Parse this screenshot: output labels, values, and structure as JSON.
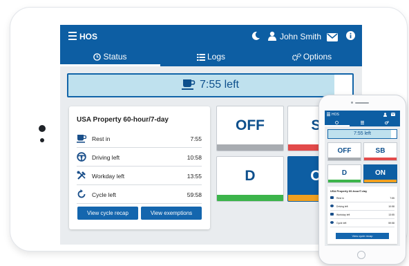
{
  "app": {
    "title": "HOS",
    "user_name": "John Smith"
  },
  "tabs": [
    {
      "label": "Status"
    },
    {
      "label": "Logs"
    },
    {
      "label": "Options"
    }
  ],
  "time_left": {
    "text": "7:55 left",
    "fraction_used": 0.94
  },
  "summary": {
    "title": "USA Property 60-hour/7-day",
    "rows": [
      {
        "icon": "coffee-cup-icon",
        "label": "Rest in",
        "value": "7:55"
      },
      {
        "icon": "steering-wheel-icon",
        "label": "Driving left",
        "value": "10:58"
      },
      {
        "icon": "tools-icon",
        "label": "Workday left",
        "value": "13:55"
      },
      {
        "icon": "cycle-icon",
        "label": "Cycle left",
        "value": "59:58"
      }
    ],
    "buttons": {
      "recap": "View cycle recap",
      "exemptions": "View exemptions"
    }
  },
  "duty_status": [
    {
      "label": "OFF",
      "strip_color": "#a8acb1",
      "active": false
    },
    {
      "label": "SB",
      "strip_color": "#e24a4a",
      "active": false
    },
    {
      "label": "D",
      "strip_color": "#3cb44b",
      "active": false
    },
    {
      "label": "ON",
      "strip_color": "#f0a020",
      "active": true
    }
  ],
  "phone": {
    "title": "HOS",
    "time_left": "7:55 left",
    "duty_status": [
      {
        "label": "OFF",
        "strip_color": "#a8acb1",
        "active": false
      },
      {
        "label": "SB",
        "strip_color": "#e24a4a",
        "active": false
      },
      {
        "label": "D",
        "strip_color": "#3cb44b",
        "active": false
      },
      {
        "label": "ON",
        "strip_color": "#f0a020",
        "active": true
      }
    ],
    "summary_title": "USA Property 60-hour/7-day",
    "rows": [
      {
        "label": "Rest in",
        "value": "7:55"
      },
      {
        "label": "Driving left",
        "value": "10:58"
      },
      {
        "label": "Workday left",
        "value": "13:55"
      },
      {
        "label": "Cycle left",
        "value": "59:58"
      }
    ],
    "recap_button": "View cycle recap"
  },
  "colors": {
    "primary": "#0d5ea3",
    "timebar_bg": "#bfe1ee",
    "screen_bg": "#e9ecef"
  }
}
